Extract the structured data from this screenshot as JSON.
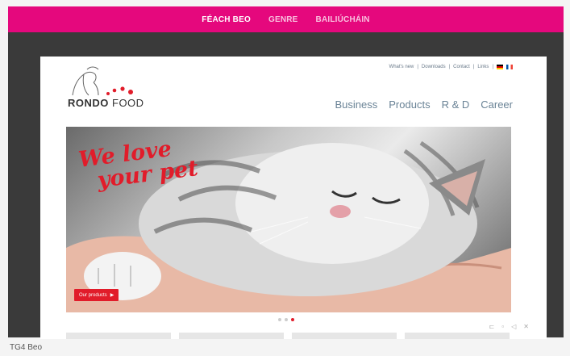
{
  "topnav": {
    "items": [
      {
        "label": "FÉACH BEO",
        "active": true
      },
      {
        "label": "GENRE",
        "active": false
      },
      {
        "label": "BAILIÚCHÁIN",
        "active": false
      }
    ],
    "color": "#e5087d"
  },
  "site": {
    "util_links": [
      "What's new",
      "Downloads",
      "Contact",
      "Links"
    ],
    "logo_text_bold": "RONDO",
    "logo_text_light": " FOOD",
    "nav": [
      "Business",
      "Products",
      "R & D",
      "Career"
    ],
    "hero_line1": "We love",
    "hero_line2": "your pet",
    "hero_button": "Our products",
    "slider_active_index": 2,
    "brand_red": "#e11c2a"
  },
  "footer": {
    "caption": "TG4 Beo"
  }
}
